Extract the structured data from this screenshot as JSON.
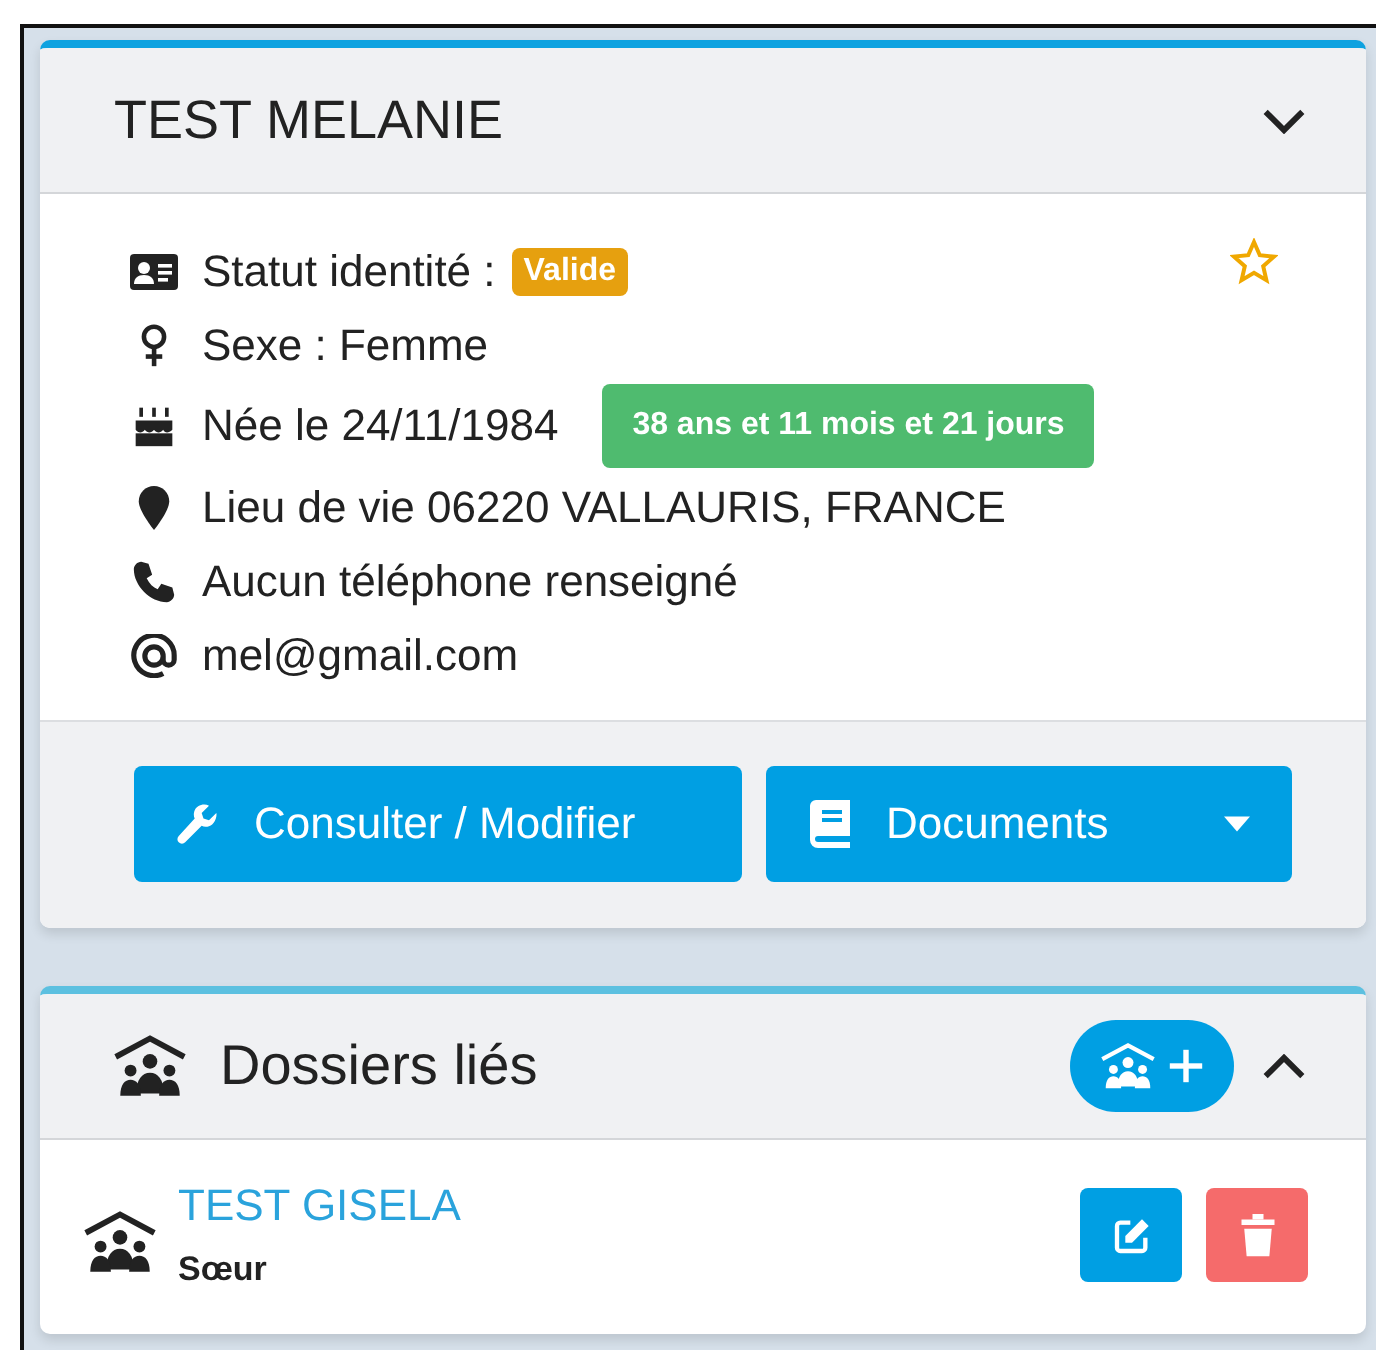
{
  "person": {
    "name": "TEST MELANIE",
    "favorite": false,
    "expanded": false,
    "info": [
      {
        "text": "Statut identité :",
        "badge": {
          "text": "Valide",
          "color": "#e6a00f"
        }
      },
      {
        "text": "Sexe : Femme"
      },
      {
        "text": "Née le 24/11/1984",
        "badge": {
          "text": "38 ans et 11 mois et 21 jours",
          "color": "#4fbb6f"
        }
      },
      {
        "text": "Lieu de vie 06220 VALLAURIS, FRANCE"
      },
      {
        "text": "Aucun téléphone renseigné"
      },
      {
        "text": "mel@gmail.com"
      }
    ],
    "buttons": [
      {
        "label": "Consulter / Modifier",
        "dropdown": false
      },
      {
        "label": "Documents",
        "dropdown": true
      }
    ]
  },
  "linked": {
    "title": "Dossiers liés",
    "expanded": true,
    "items": [
      {
        "name": "TEST GISELA",
        "relation": "Sœur"
      }
    ]
  }
}
